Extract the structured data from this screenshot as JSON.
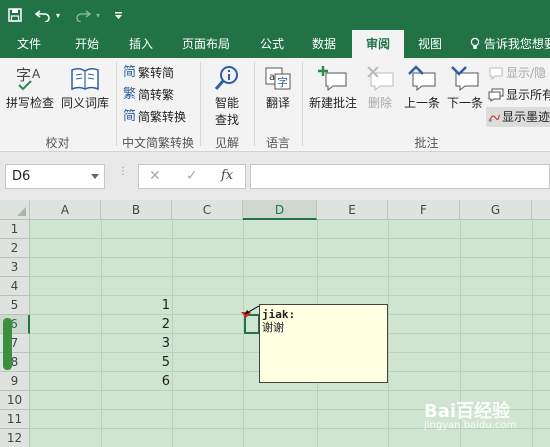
{
  "quick_access": {
    "icons": [
      "save-icon",
      "undo-icon",
      "undo-dropdown-icon",
      "redo-icon",
      "redo-dropdown-icon",
      "customize-quick-access-icon"
    ]
  },
  "tabs": [
    "文件",
    "开始",
    "插入",
    "页面布局",
    "公式",
    "数据",
    "审阅",
    "视图"
  ],
  "active_tab": "审阅",
  "tell_me": "告诉我您想要",
  "ribbon": {
    "proofing": {
      "spellcheck": "拼写检查",
      "thesaurus": "同义词库",
      "group": "校对"
    },
    "chinese_conversion": {
      "trad_to_simp": "繁转简",
      "simp_to_trad": "简转繁",
      "convert": "简繁转换",
      "group": "中文简繁转换"
    },
    "insights": {
      "smart_lookup_line1": "智能",
      "smart_lookup_line2": "查找",
      "group": "见解"
    },
    "language": {
      "translate": "翻译",
      "group": "语言"
    },
    "comments": {
      "new_comment": "新建批注",
      "delete": "删除",
      "previous": "上一条",
      "next": "下一条",
      "show_hide": "显示/隐",
      "show_all": "显示所有",
      "show_ink": "显示墨迹",
      "group": "批注"
    }
  },
  "formula_bar": {
    "name_box": "D6",
    "cancel_icon": "✕",
    "enter_icon": "✓",
    "fx_label": "fx",
    "formula": ""
  },
  "sheet": {
    "columns": [
      "A",
      "B",
      "C",
      "D",
      "E",
      "F",
      "G"
    ],
    "selected_column": "D",
    "rows": [
      "1",
      "2",
      "3",
      "4",
      "5",
      "6",
      "7",
      "8",
      "9",
      "10",
      "11",
      "12"
    ],
    "selected_row": "6",
    "active_cell": "D6",
    "b_values": [
      {
        "row": "5",
        "value": "1"
      },
      {
        "row": "6",
        "value": "2"
      },
      {
        "row": "7",
        "value": "3"
      },
      {
        "row": "8",
        "value": "5"
      },
      {
        "row": "9",
        "value": "6"
      }
    ]
  },
  "comment": {
    "author": "jiak:",
    "text": "谢谢"
  },
  "watermark": {
    "brand": "Bai百经验",
    "url": "jingyan.baidu.com"
  },
  "colors": {
    "excel_green": "#217346",
    "sheet_bg": "#cfe5cf",
    "comment_bg": "#ffffe1",
    "comment_indicator": "#e02020"
  }
}
